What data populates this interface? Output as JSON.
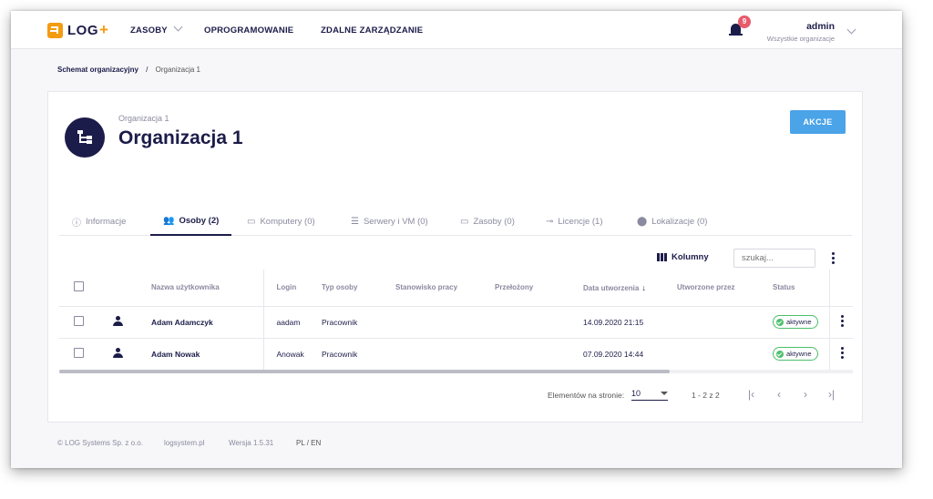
{
  "logo": {
    "text": "LOG",
    "plus": "+"
  },
  "nav": {
    "items": [
      {
        "label": "ZASOBY",
        "has_dropdown": true
      },
      {
        "label": "OPROGRAMOWANIE"
      },
      {
        "label": "ZDALNE ZARZĄDZANIE"
      }
    ]
  },
  "notifications": {
    "count": "9"
  },
  "user": {
    "name": "admin",
    "scope": "Wszystkie organizacje"
  },
  "breadcrumb": {
    "root": "Schemat organizacyjny",
    "separator": "/",
    "current": "Organizacja 1"
  },
  "org": {
    "subtitle": "Organizacja 1",
    "title": "Organizacja 1",
    "action_label": "AKCJE"
  },
  "tabs": [
    {
      "label": "Informacje",
      "icon": "info-icon"
    },
    {
      "label": "Osoby (2)",
      "icon": "people-icon",
      "active": true
    },
    {
      "label": "Komputery (0)",
      "icon": "laptop-icon"
    },
    {
      "label": "Serwery i VM (0)",
      "icon": "server-icon"
    },
    {
      "label": "Zasoby (0)",
      "icon": "devices-icon"
    },
    {
      "label": "Licencje (1)",
      "icon": "key-icon"
    },
    {
      "label": "Lokalizacje (0)",
      "icon": "location-pin-icon"
    }
  ],
  "toolbar": {
    "columns_label": "Kolumny",
    "search_placeholder": "szukaj..."
  },
  "table": {
    "columns": [
      "Nazwa użytkownika",
      "Login",
      "Typ osoby",
      "Stanowisko pracy",
      "Przełożony",
      "Data utworzenia",
      "Utworzone przez",
      "Status"
    ],
    "sort_icon": "arrow-down-icon",
    "rows": [
      {
        "name": "Adam Adamczyk",
        "login": "aadam",
        "type": "Pracownik",
        "position": "",
        "supervisor": "",
        "created": "14.09.2020 21:15",
        "created_by": "",
        "status": "aktywne"
      },
      {
        "name": "Adam Nowak",
        "login": "Anowak",
        "type": "Pracownik",
        "position": "",
        "supervisor": "",
        "created": "07.09.2020 14:44",
        "created_by": "",
        "status": "aktywne"
      }
    ]
  },
  "pagination": {
    "per_page_label": "Elementów na stronie:",
    "per_page": "10",
    "range": "1 - 2 z 2"
  },
  "footer": {
    "copyright": "© LOG Systems Sp. z o.o.",
    "website": "logsystem.pl",
    "version": "Wersja 1.5.31",
    "languages": "PL / EN"
  },
  "colors": {
    "primary": "#1c1c4a",
    "accent": "#f39c12",
    "button": "#4ba3e8",
    "status_active": "#4cbf6a",
    "badge": "#e85a6a"
  }
}
